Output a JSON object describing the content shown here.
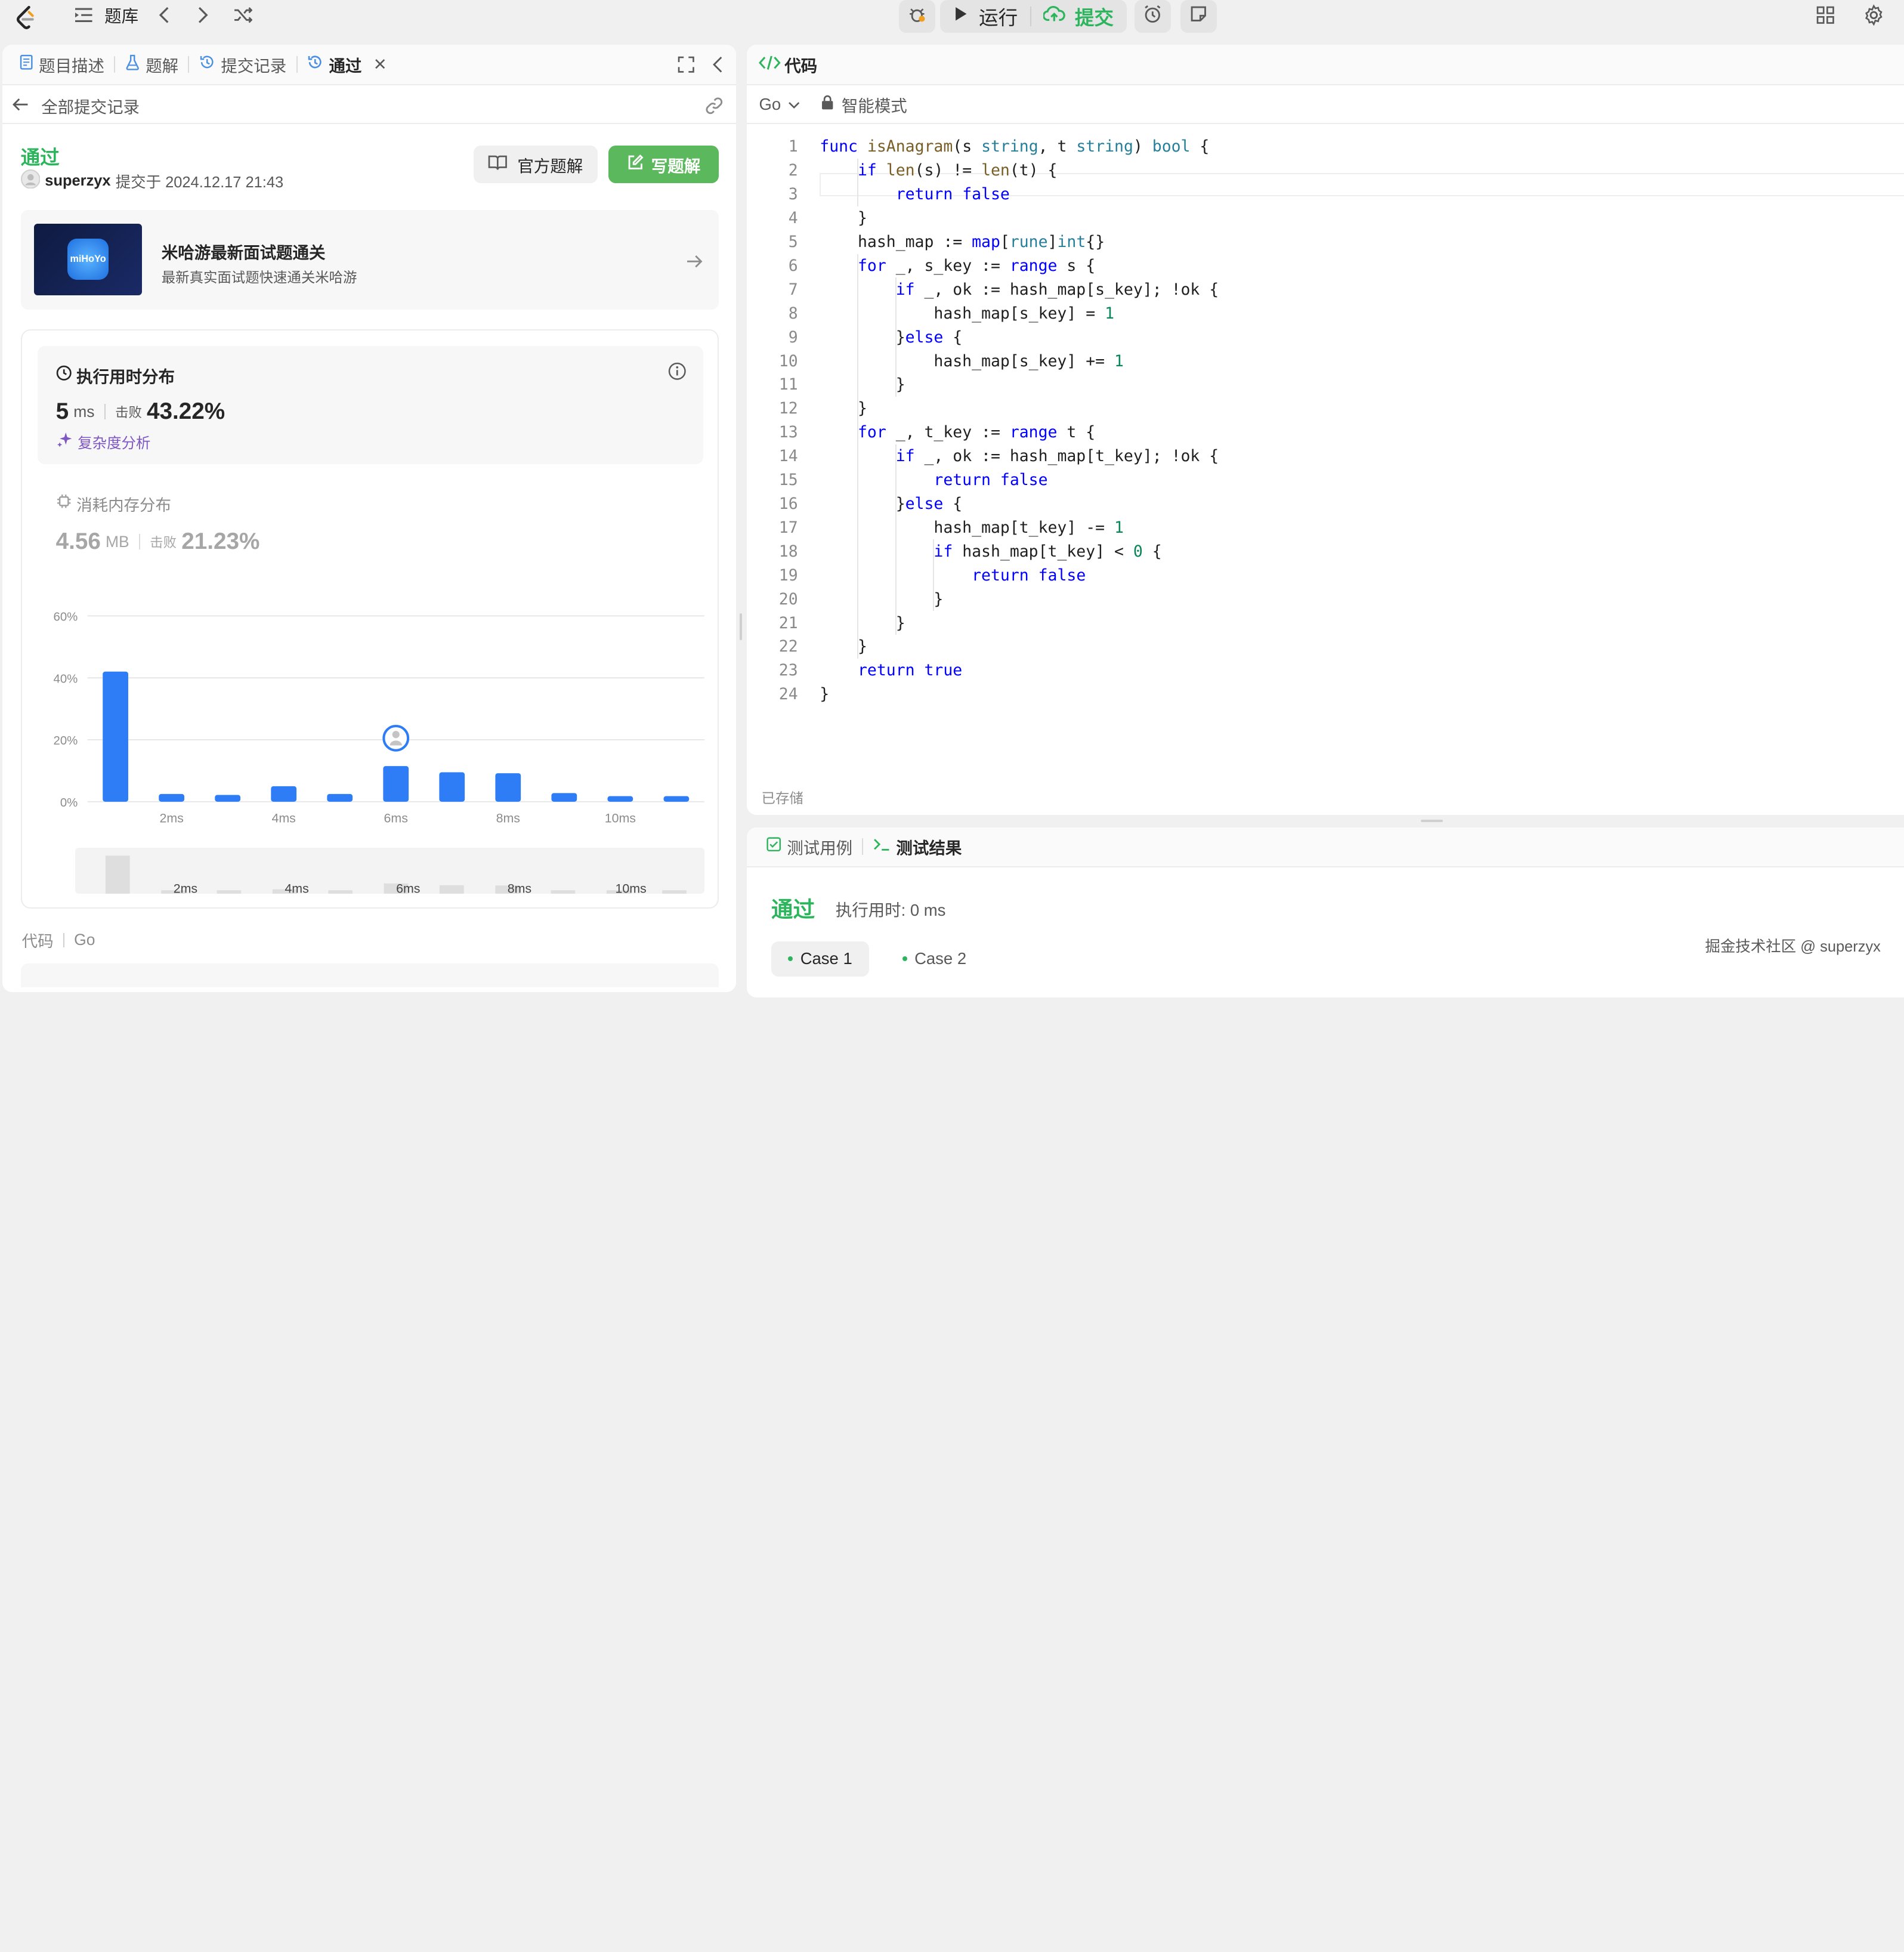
{
  "topbar": {
    "problem_list": "题库",
    "run": "运行",
    "submit": "提交"
  },
  "left_tabs": [
    {
      "label": "题目描述",
      "icon": "document-icon"
    },
    {
      "label": "题解",
      "icon": "flask-icon"
    },
    {
      "label": "提交记录",
      "icon": "history-icon"
    },
    {
      "label": "通过",
      "icon": "history-icon"
    }
  ],
  "back_link": "全部提交记录",
  "submission": {
    "status": "通过",
    "user": "superzyx",
    "submitted_text": "提交于 2024.12.17 21:43",
    "official_solution": "官方题解",
    "write_solution": "写题解"
  },
  "promo": {
    "logo_text": "miHoYo",
    "title": "米哈游最新面试题通关",
    "subtitle": "最新真实面试题快速通关米哈游"
  },
  "runtime": {
    "title": "执行用时分布",
    "value": "5",
    "unit": "ms",
    "beats_label": "击败",
    "beats": "43.22%",
    "complexity": "复杂度分析"
  },
  "memory": {
    "title": "消耗内存分布",
    "value": "4.56",
    "unit": "MB",
    "beats_label": "击败",
    "beats": "21.23%"
  },
  "chart_data": {
    "type": "bar",
    "categories": [
      "1ms",
      "2ms",
      "3ms",
      "4ms",
      "5ms",
      "6ms",
      "7ms",
      "8ms",
      "9ms",
      "10ms",
      "11ms"
    ],
    "x_tick_labels": [
      "2ms",
      "4ms",
      "6ms",
      "8ms",
      "10ms"
    ],
    "y_tick_labels": [
      "0%",
      "20%",
      "40%",
      "60%"
    ],
    "values": [
      42,
      2.5,
      2.2,
      5,
      2.5,
      11.5,
      9.5,
      9.2,
      2.8,
      1.8,
      1.8
    ],
    "highlight_index": 5,
    "ylim": [
      0,
      60
    ],
    "xlabel": "",
    "ylabel": "",
    "grid": true
  },
  "code_footer": {
    "label": "代码",
    "lang": "Go"
  },
  "editor": {
    "title": "代码",
    "language": "Go",
    "mode": "智能模式",
    "saved": "已存储",
    "lines": [
      "func isAnagram(s string, t string) bool {",
      "    if len(s) != len(t) {",
      "        return false",
      "    }",
      "    hash_map := map[rune]int{}",
      "    for _, s_key := range s {",
      "        if _, ok := hash_map[s_key]; !ok {",
      "            hash_map[s_key] = 1",
      "        }else {",
      "            hash_map[s_key] += 1",
      "        }",
      "    }",
      "    for _, t_key := range t {",
      "        if _, ok := hash_map[t_key]; !ok {",
      "            return false",
      "        }else {",
      "            hash_map[t_key] -= 1",
      "            if hash_map[t_key] < 0 {",
      "                return false",
      "            }",
      "        }",
      "    }",
      "    return true",
      "}"
    ]
  },
  "results": {
    "tab_testcase": "测试用例",
    "tab_result": "测试结果",
    "status": "通过",
    "runtime": "执行用时: 0 ms",
    "cases": [
      "Case 1",
      "Case 2"
    ]
  },
  "watermark": "掘金技术社区 @ superzyx",
  "colors": {
    "accent_green": "#2db55d",
    "bar_blue": "#2e7df6",
    "button_green": "#5cb85c"
  }
}
